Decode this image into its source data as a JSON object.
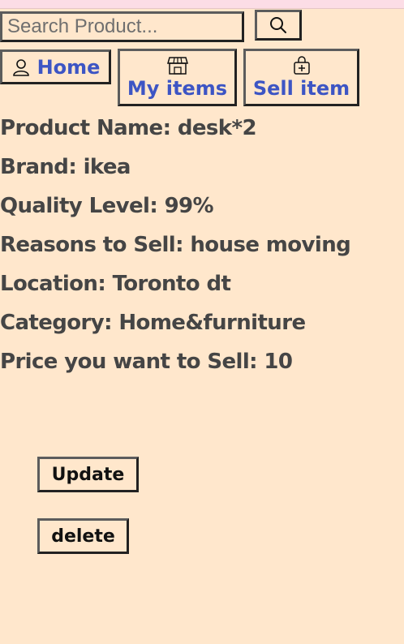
{
  "search": {
    "placeholder": "Search Product...",
    "value": ""
  },
  "nav": {
    "home_label": "Home",
    "myitems_label": "My items",
    "sell_label": "Sell item"
  },
  "product": [
    {
      "label": "Product Name",
      "value": "desk*2"
    },
    {
      "label": "Brand",
      "value": "ikea"
    },
    {
      "label": "Quality Level",
      "value": "99%"
    },
    {
      "label": "Reasons to Sell",
      "value": "house moving"
    },
    {
      "label": "Location",
      "value": "Toronto dt"
    },
    {
      "label": "Category",
      "value": "Home&furniture"
    },
    {
      "label": "Price you want to Sell",
      "value": "10"
    }
  ],
  "actions": {
    "update_label": "Update",
    "delete_label": "delete"
  },
  "colors": {
    "background": "#ffe7cc",
    "nav_text": "#3d55c4",
    "info_text": "#454545"
  },
  "icons": {
    "search": "search-icon",
    "home": "user-icon",
    "myitems": "store-icon",
    "sell": "bag-plus-icon"
  }
}
